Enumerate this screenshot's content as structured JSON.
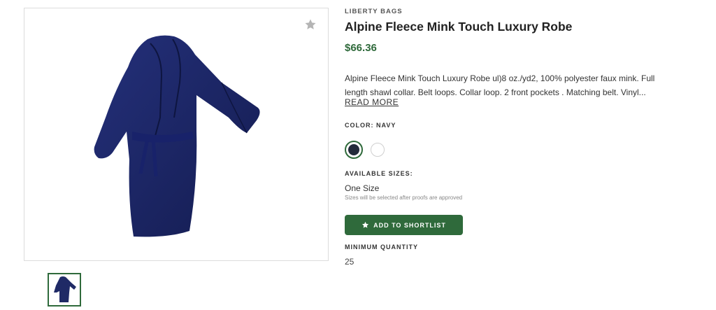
{
  "product": {
    "brand": "LIBERTY BAGS",
    "title": "Alpine Fleece Mink Touch Luxury Robe",
    "price": "$66.36",
    "description": "Alpine Fleece Mink Touch Luxury Robe ul)8 oz./yd2, 100% polyester faux mink. Full length shawl collar. Belt loops. Collar loop. 2 front pockets . Matching belt. Vinyl...",
    "read_more": "READ MORE"
  },
  "color": {
    "label": "COLOR: NAVY",
    "swatches": [
      {
        "name": "Navy",
        "hex": "#232a3b",
        "selected": true
      },
      {
        "name": "White",
        "hex": "#ffffff",
        "selected": false
      }
    ]
  },
  "sizes": {
    "label": "AVAILABLE SIZES:",
    "value": "One Size",
    "note": "Sizes will be selected after proofs are approved"
  },
  "actions": {
    "add_to_shortlist": "ADD TO SHORTLIST"
  },
  "minimum_quantity": {
    "label": "MINIMUM QUANTITY",
    "value": "25"
  },
  "icons": {
    "favorite": "star-icon",
    "shortlist": "star-icon"
  },
  "colors": {
    "accent": "#2f6a3b",
    "robe": "#1f2a66"
  }
}
